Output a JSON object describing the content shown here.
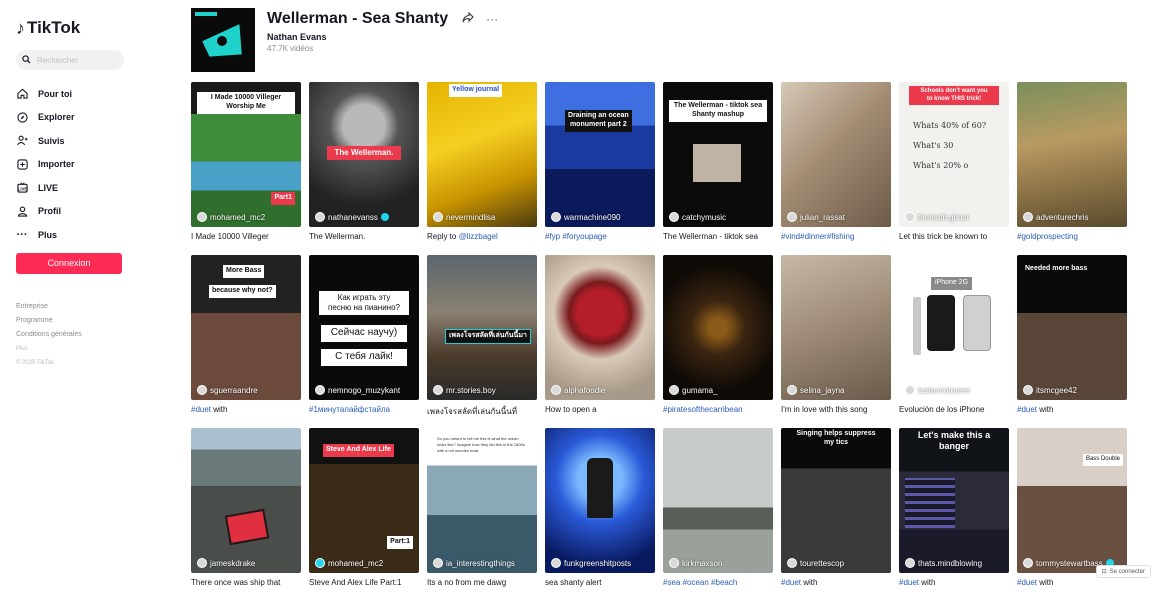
{
  "sidebar": {
    "logo": "TikTok",
    "search_placeholder": "Rechercher",
    "nav": [
      {
        "label": "Pour toi",
        "icon": "home-icon"
      },
      {
        "label": "Explorer",
        "icon": "compass-icon"
      },
      {
        "label": "Suivis",
        "icon": "following-icon"
      },
      {
        "label": "Importer",
        "icon": "upload-icon"
      },
      {
        "label": "LIVE",
        "icon": "live-icon"
      },
      {
        "label": "Profil",
        "icon": "profile-icon"
      },
      {
        "label": "Plus",
        "icon": "more-icon"
      }
    ],
    "login": "Connexion",
    "footer": [
      "Entreprise",
      "Programme",
      "Conditions générales",
      "Plus",
      "© 2025 TikTok"
    ]
  },
  "header": {
    "title": "Wellerman - Sea Shanty",
    "artist": "Nathan Evans",
    "count": "47.7K vidéos"
  },
  "videos": [
    {
      "user": "mohamed_mc2",
      "caption": "I Made 10000 Villeger",
      "overlay": [
        "I Made 10000 Villeger",
        "Worship Me",
        "Part1"
      ]
    },
    {
      "user": "nathanevanss",
      "verified": true,
      "caption": "The Wellerman.",
      "overlay": [
        "The Wellerman."
      ]
    },
    {
      "user": "nevermindlisa",
      "caption_prefix": "Reply to ",
      "caption_link": "@lizzbagel",
      "overlay": [
        "Yellow journal"
      ]
    },
    {
      "user": "warmachine090",
      "caption": "#fyp #foryoupage",
      "tag": true,
      "overlay": [
        "Draining an ocean",
        "monument part 2"
      ]
    },
    {
      "user": "catchymusic",
      "caption": "The Wellerman - tiktok sea",
      "overlay": [
        "The Wellerman - tiktok sea",
        "Shanty mashup"
      ]
    },
    {
      "user": "julian_rassat",
      "caption": "#vind#dinner#fishing",
      "tag": true
    },
    {
      "user": "themath.ghost",
      "caption": "Let this trick be known to",
      "overlay": [
        "Schools don't want you",
        "to know THIS trick!"
      ]
    },
    {
      "user": "adventurechris",
      "caption": "#goldprospecting",
      "tag": true
    },
    {
      "user": "sguerraandre",
      "caption_tag": "#duet",
      "caption_rest": " with",
      "overlay": [
        "More Bass",
        "because why not?"
      ]
    },
    {
      "user": "nemnogo_muzykant",
      "caption": "#1минуталайфстайла",
      "tag": true,
      "overlay": [
        "Как играть эту",
        "песню на пианино?",
        "Сейчас научу)",
        "С тебя лайк!"
      ]
    },
    {
      "user": "mr.stories.boy",
      "caption": "เพลงโจรสลัดที่เล่นกันนี้นที่",
      "overlay": [
        "เพลงโจรสลัดที่เล่นกันนี้มา"
      ]
    },
    {
      "user": "alphafoodie",
      "caption": "How to open a"
    },
    {
      "user": "gumama_",
      "caption": "#piratesofthecarribean",
      "tag": true
    },
    {
      "user": "selina_jayna",
      "caption": "I'm in love with this song"
    },
    {
      "user": "tustecnotruces",
      "caption": "Evolución de los iPhone",
      "overlay": [
        "iPhone 2G"
      ]
    },
    {
      "user": "itsmcgee42",
      "caption_tag": "#duet",
      "caption_rest": " with",
      "overlay": [
        "Needed more bass"
      ]
    },
    {
      "user": "jameskdrake",
      "caption": "There once was ship that"
    },
    {
      "user": "mohamed_mc2",
      "caption": "Steve And Alex Life Part:1",
      "overlay": [
        "Steve And Alex Life",
        "Part:1"
      ]
    },
    {
      "user": "ia_interestingthings",
      "caption": "Its a no from me dawg"
    },
    {
      "user": "funkgreenshitposts",
      "caption": "sea shanty alert"
    },
    {
      "user": "kirkmaxson",
      "caption": "#sea #ocean #beach",
      "tag": true
    },
    {
      "user": "tourettescop",
      "caption_tag": "#duet",
      "caption_rest": " with",
      "overlay": [
        "Singing helps suppress",
        "my tics"
      ]
    },
    {
      "user": "thats.mindblowing",
      "caption_tag": "#duet",
      "caption_rest": " with",
      "overlay": [
        "Let's make this a",
        "banger"
      ]
    },
    {
      "user": "tommystewartbass",
      "verified": true,
      "caption_tag": "#duet",
      "caption_rest": " with",
      "overlay": [
        "Bass Double"
      ]
    }
  ],
  "signin": "Se connecter",
  "colors": {
    "brand": "#fe2c55",
    "tag": "#2b5db9",
    "verified": "#20d5ec"
  }
}
